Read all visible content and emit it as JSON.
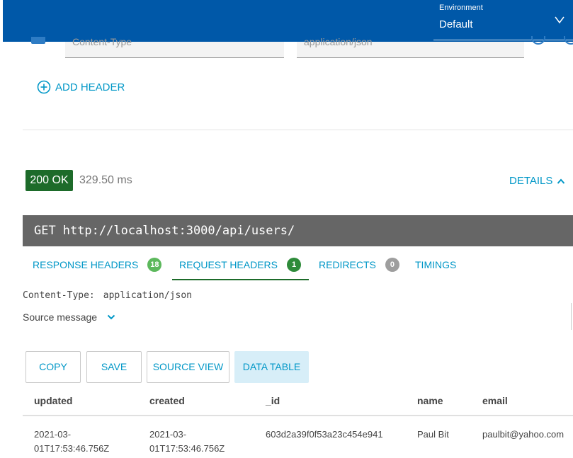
{
  "environment": {
    "label": "Environment",
    "value": "Default"
  },
  "headers_editor": {
    "partial_name": "Content-Type",
    "partial_value": "application/json",
    "add_header_label": "ADD HEADER"
  },
  "response": {
    "status": "200 OK",
    "time": "329.50 ms",
    "details_label": "DETAILS",
    "method": "GET",
    "url": "http://localhost:3000/api/users/"
  },
  "tabs": [
    {
      "label": "RESPONSE HEADERS",
      "count": "18",
      "count_color": "#5cb85c"
    },
    {
      "label": "REQUEST HEADERS",
      "count": "1",
      "count_color": "#2e8b3a"
    },
    {
      "label": "REDIRECTS",
      "count": "0",
      "count_color": "#9e9e9e"
    },
    {
      "label": "TIMINGS"
    }
  ],
  "request_headers": {
    "name": "Content-Type:",
    "value": "application/json",
    "source_message_label": "Source message"
  },
  "actions": {
    "copy": "COPY",
    "save": "SAVE",
    "source_view": "SOURCE VIEW",
    "data_table": "DATA TABLE"
  },
  "table": {
    "columns": [
      "updated",
      "created",
      "_id",
      "name",
      "email"
    ],
    "rows": [
      {
        "updated_1": "2021-03-",
        "updated_2": "01T17:53:46.756Z",
        "created_1": "2021-03-",
        "created_2": "01T17:53:46.756Z",
        "_id": "603d2a39f0f53a23c454e941",
        "name": "Paul Bit",
        "email": "paulbit@yahoo.com"
      }
    ]
  },
  "colors": {
    "header_bg": "#0058a8",
    "accent": "#0097c7",
    "status_ok": "#1d6b2a"
  }
}
